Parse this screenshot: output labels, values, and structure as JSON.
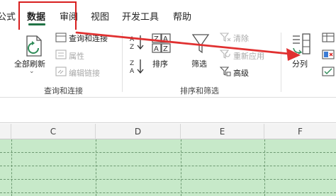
{
  "tabs": [
    {
      "label": "公式"
    },
    {
      "label": "数据"
    },
    {
      "label": "审阅"
    },
    {
      "label": "视图"
    },
    {
      "label": "开发工具"
    },
    {
      "label": "帮助"
    }
  ],
  "ribbon": {
    "refresh_all": {
      "label": "全部刷新"
    },
    "queries": {
      "items": [
        {
          "label": "查询和连接"
        },
        {
          "label": "属性"
        },
        {
          "label": "编辑链接"
        }
      ],
      "group_label": "查询和连接"
    },
    "sort": {
      "label": "排序"
    },
    "filter": {
      "label": "筛选"
    },
    "filter_small": [
      {
        "label": "清除"
      },
      {
        "label": "重新应用"
      },
      {
        "label": "高级"
      }
    ],
    "sort_filter_group_label": "排序和筛选",
    "text_to_columns": {
      "label": "分列"
    }
  },
  "sheet": {
    "columns": [
      {
        "label": "C"
      },
      {
        "label": "D"
      },
      {
        "label": "E"
      },
      {
        "label": "F"
      }
    ]
  },
  "colors": {
    "accent": "#217346",
    "highlight_red": "#d81e1e",
    "cell_fill": "#c7e9c9"
  }
}
